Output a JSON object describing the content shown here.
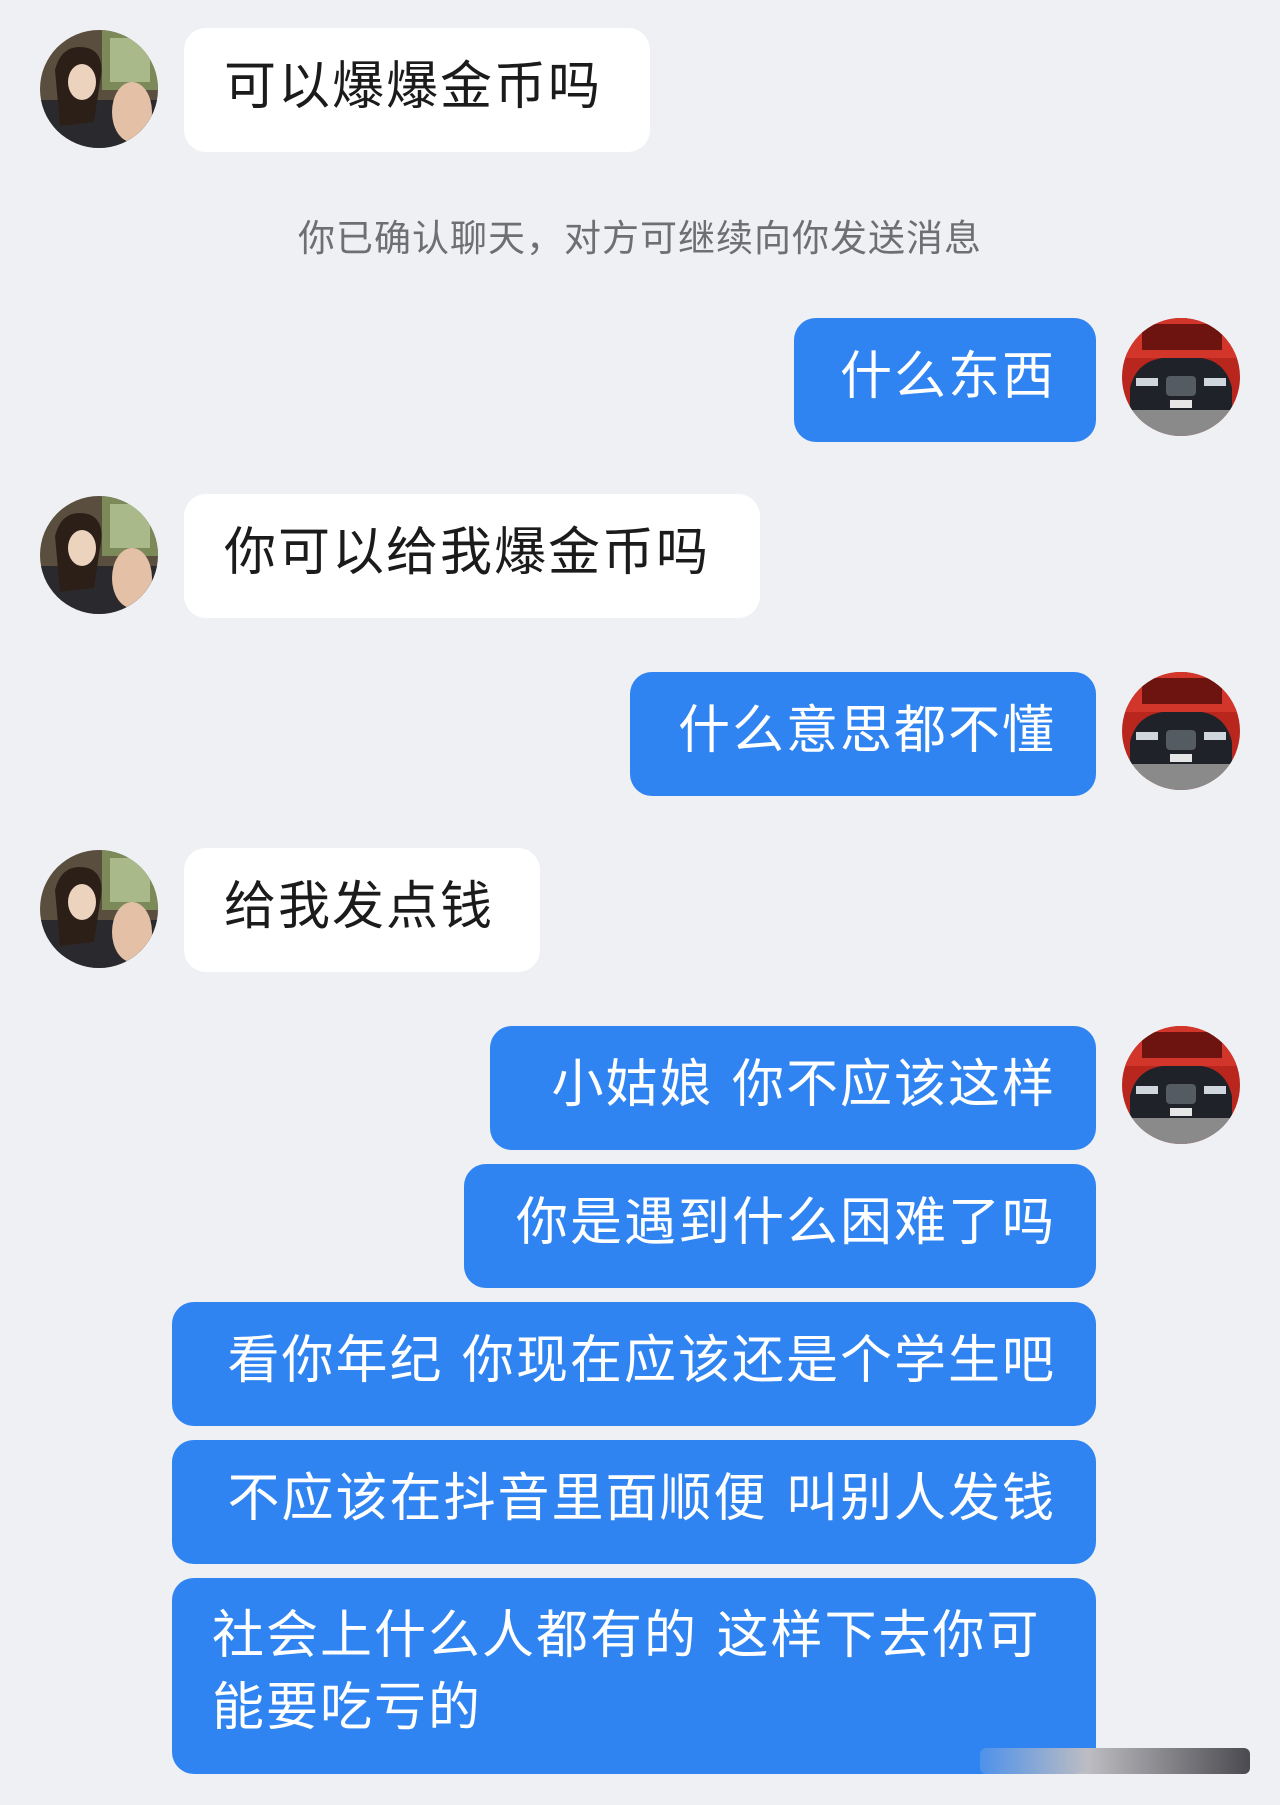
{
  "system_note": "你已确认聊天，对方可继续向你发送消息",
  "avatars": {
    "contact": "girl-photo-avatar",
    "self": "car-photo-avatar"
  },
  "messages": [
    {
      "side": "in",
      "text": "可以爆爆金币吗"
    },
    {
      "side": "out",
      "text": "什么东西"
    },
    {
      "side": "in",
      "text": "你可以给我爆金币吗"
    },
    {
      "side": "out",
      "text": "什么意思都不懂"
    },
    {
      "side": "in",
      "text": "给我发点钱"
    },
    {
      "side": "out",
      "text": "小姑娘 你不应该这样"
    },
    {
      "side": "out",
      "text": "你是遇到什么困难了吗"
    },
    {
      "side": "out",
      "text": "看你年纪 你现在应该还是个学生吧"
    },
    {
      "side": "out",
      "text": "不应该在抖音里面顺便 叫别人发钱"
    },
    {
      "side": "out",
      "text": "社会上什么人都有的 这样下去你可能要吃亏的"
    }
  ],
  "colors": {
    "background": "#eef0f3",
    "incoming_bubble": "#ffffff",
    "outgoing_bubble": "#2f84f2"
  }
}
